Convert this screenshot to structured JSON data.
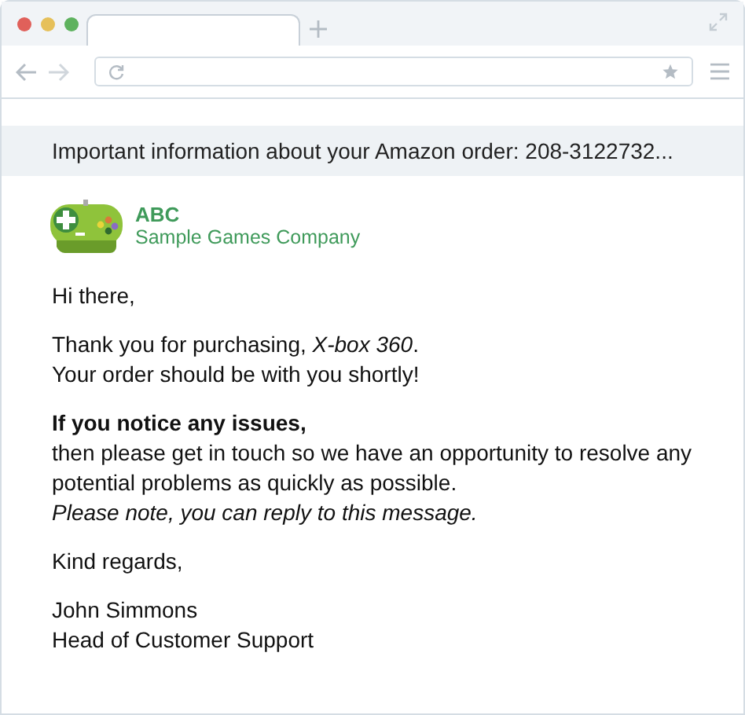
{
  "browser": {
    "tabs": [
      {
        "selected": true
      }
    ]
  },
  "email": {
    "subject": "Important information about your Amazon order: 208-3122732...",
    "sender": {
      "name": "ABC",
      "company": "Sample Games Company"
    },
    "paragraphs": [
      {
        "lines": [
          {
            "text": "Hi there,",
            "kind": "plain"
          }
        ]
      },
      {
        "lines": [
          {
            "text": "Thank you for purchasing, *X-box 360*.",
            "kind": "plain"
          },
          {
            "text": "Your order should be with you shortly!",
            "kind": "plain"
          }
        ]
      },
      {
        "lines": [
          {
            "text": "If you notice any issues,",
            "kind": "heading"
          },
          {
            "text": "then please get in touch so we have an opportunity to resolve any potential problems as quickly as possible.",
            "kind": "plain"
          },
          {
            "text": "Please note, you can reply to this message.",
            "kind": "note"
          }
        ]
      },
      {
        "lines": [
          {
            "text": "Kind regards,",
            "kind": "plain"
          }
        ]
      },
      {
        "lines": [
          {
            "text": "John Simmons",
            "kind": "plain"
          },
          {
            "text": "Head of Customer Support",
            "kind": "plain"
          }
        ]
      }
    ]
  }
}
